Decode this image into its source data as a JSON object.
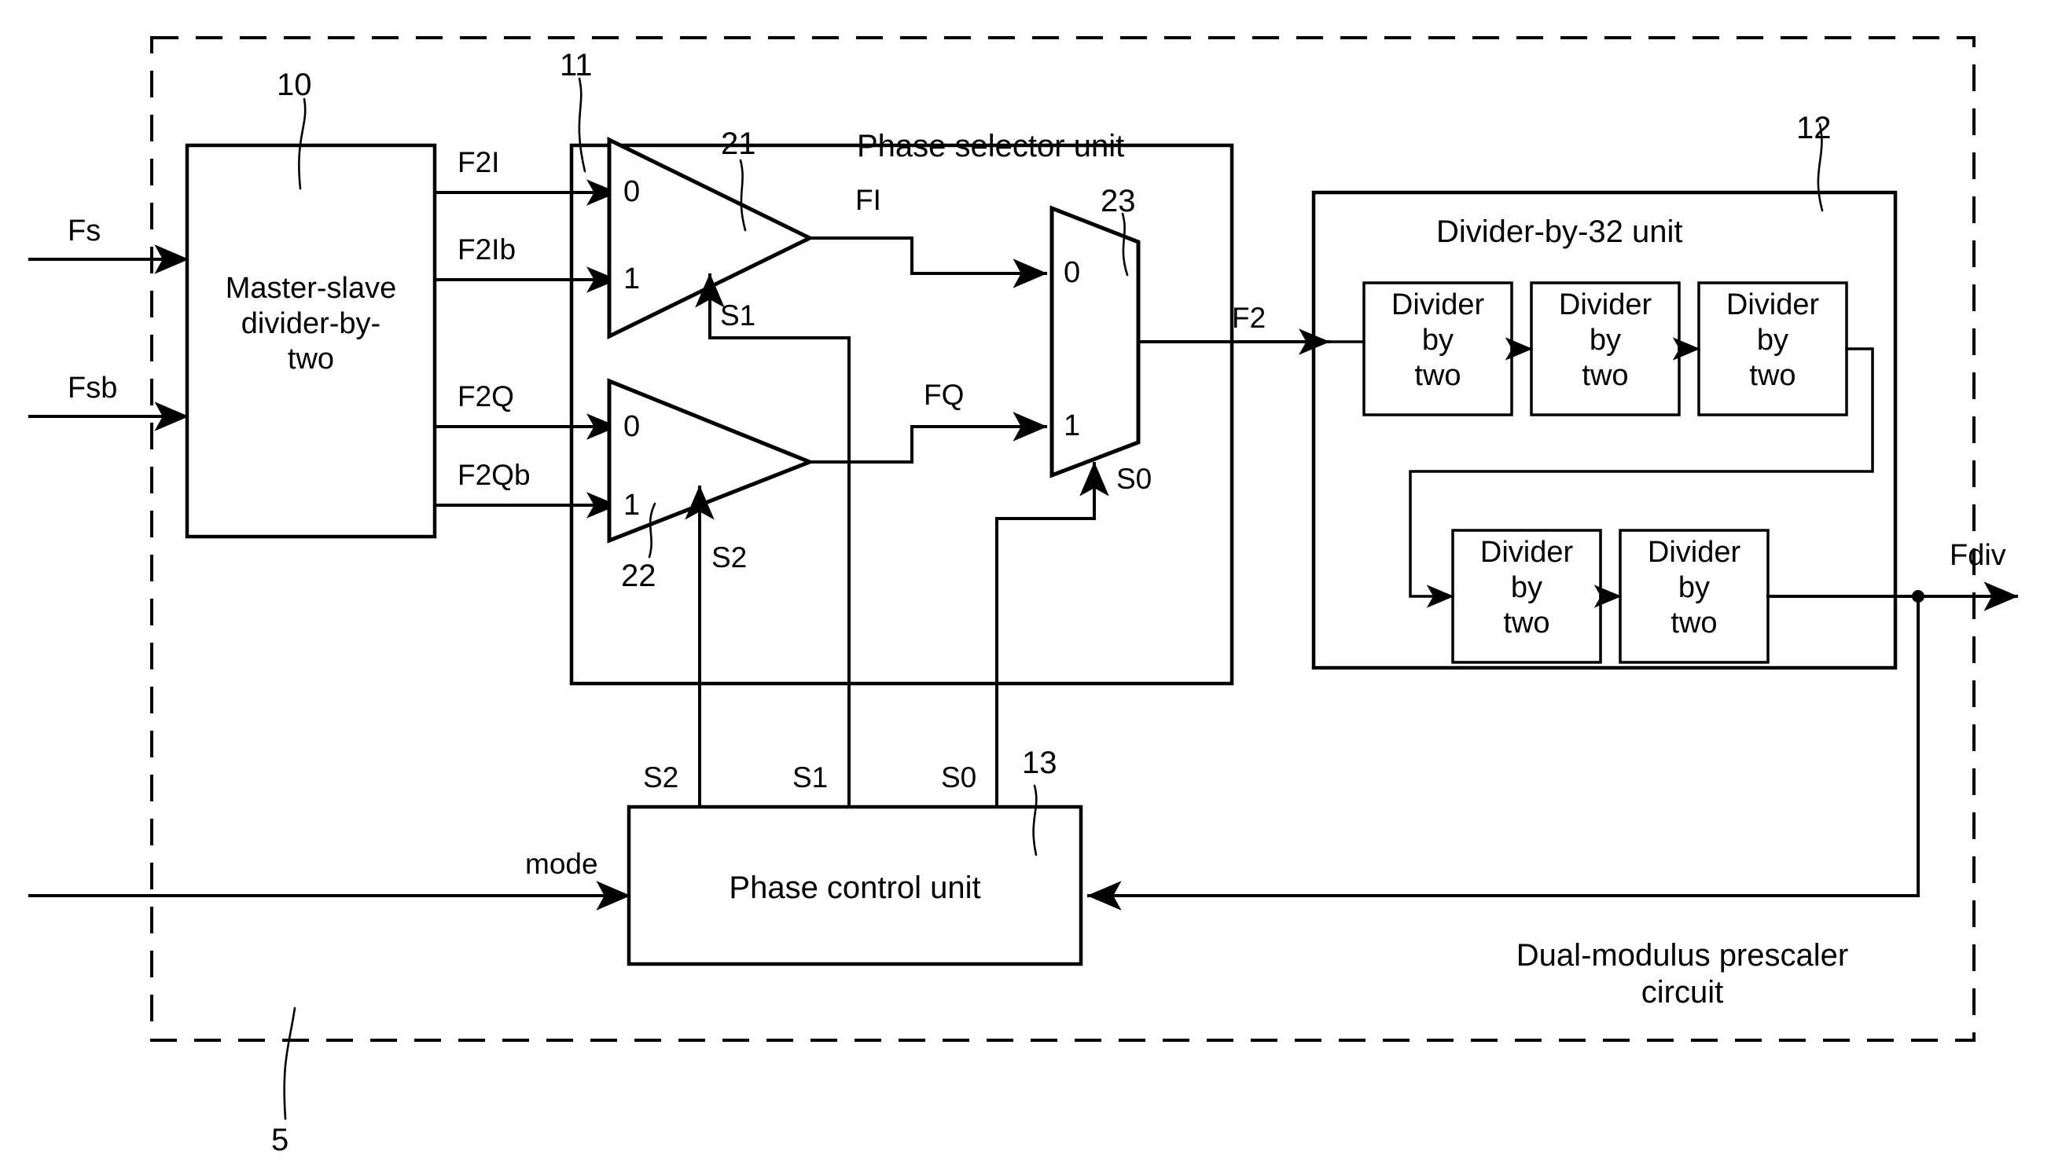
{
  "diagram": {
    "figure_label": "5",
    "outer_caption_line1": "Dual-modulus prescaler",
    "outer_caption_line2": "circuit"
  },
  "ports": {
    "in_clock": "Fs",
    "in_clock_sub": "s",
    "in_clock_bar": "Fsb",
    "in_clock_bar_sub": "Sb",
    "in_mode": "mode",
    "out_div": "Fdiv"
  },
  "blocks": {
    "master_slave": {
      "ref": "10",
      "line1": "Master-slave",
      "line2": "divider-by-",
      "line3": "two"
    },
    "phase_selector": {
      "ref": "11",
      "title": "Phase selector unit"
    },
    "divider32": {
      "ref": "12",
      "title": "Divider-by-32 unit"
    },
    "phase_control": {
      "ref": "13",
      "title": "Phase control unit"
    }
  },
  "muxes": [
    {
      "ref": "21",
      "in0": "0",
      "in1": "1",
      "select": "S1"
    },
    {
      "ref": "22",
      "in0": "0",
      "in1": "1",
      "select": "S2"
    },
    {
      "ref": "23",
      "in0": "0",
      "in1": "1",
      "select": "S0"
    }
  ],
  "signals": {
    "f2i": "F2I",
    "f2ib": "F2Ib",
    "f2q": "F2Q",
    "f2qb": "F2Qb",
    "fi": "FI",
    "fq": "FQ",
    "f2": "F2",
    "s0": "S0",
    "s1": "S1",
    "s2": "S2"
  },
  "control_bus": {
    "s2": "S2",
    "s1": "S1",
    "s0": "S0"
  },
  "dividers": {
    "cell_line1": "Divider",
    "cell_line2": "by",
    "cell_line3": "two",
    "top_row_count": 3,
    "bottom_row_count": 2
  },
  "colors": {
    "ink": "#000000",
    "paper": "#ffffff"
  }
}
